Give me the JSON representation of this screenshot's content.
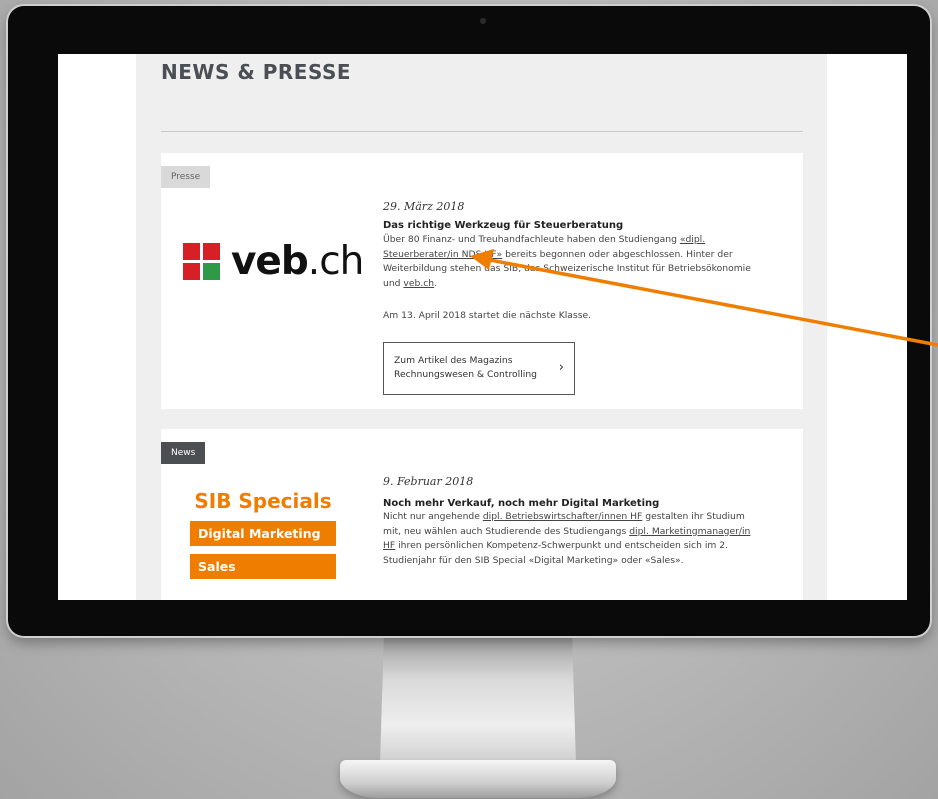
{
  "page": {
    "title": "NEWS & PRESSE"
  },
  "articles": [
    {
      "tag": "Presse",
      "date": "29. März 2018",
      "headline": "Das richtige Werkzeug für Steuerberatung",
      "body_parts": {
        "p1a": "Über 80 Finanz- und Treuhandfachleute haben den Studiengang ",
        "link1": "«dipl. Steuerberater/in NDS HF»",
        "p1b": " bereits begonnen oder abgeschlossen. Hinter der Weiterbildung stehen das SIB, das Schweizerische Institut für Betriebsökonomie und ",
        "link2": "veb.ch",
        "p1c": ".",
        "p2": "Am 13. April 2018 startet die nächste Klasse."
      },
      "cta_label": "Zum Artikel des Magazins Rechnungswesen & Controlling",
      "logo": {
        "text_bold": "veb",
        "text_normal": ".ch",
        "colors": [
          "#d71f26",
          "#d71f26",
          "#d71f26",
          "#2e9a47"
        ]
      }
    },
    {
      "tag": "News",
      "date": "9. Februar 2018",
      "headline": "Noch mehr Verkauf, noch mehr Digital Marketing",
      "body_parts": {
        "p1a": "Nicht nur angehende ",
        "link1": "dipl. Betriebswirtschafter/innen HF",
        "p1b": " gestalten ihr Studium mit, neu wählen auch Studierende des Studiengangs ",
        "link2": "dipl. Marketingmanager/in HF",
        "p1c": " ihren persönlichen Kompetenz-Schwerpunkt und entscheiden sich im 2. Studienjahr für den SIB Special «Digital Marketing» oder «Sales»."
      },
      "logo": {
        "title": "SIB Specials",
        "items": [
          "Digital Marketing",
          "Sales"
        ],
        "color": "#ef7d00"
      }
    }
  ],
  "annotation": {
    "arrow_color": "#ef7d00"
  },
  "colors": {
    "accent_orange": "#ef7d00",
    "tag_news_bg": "#4c4f52",
    "tag_presse_bg": "#d9d9d9"
  }
}
